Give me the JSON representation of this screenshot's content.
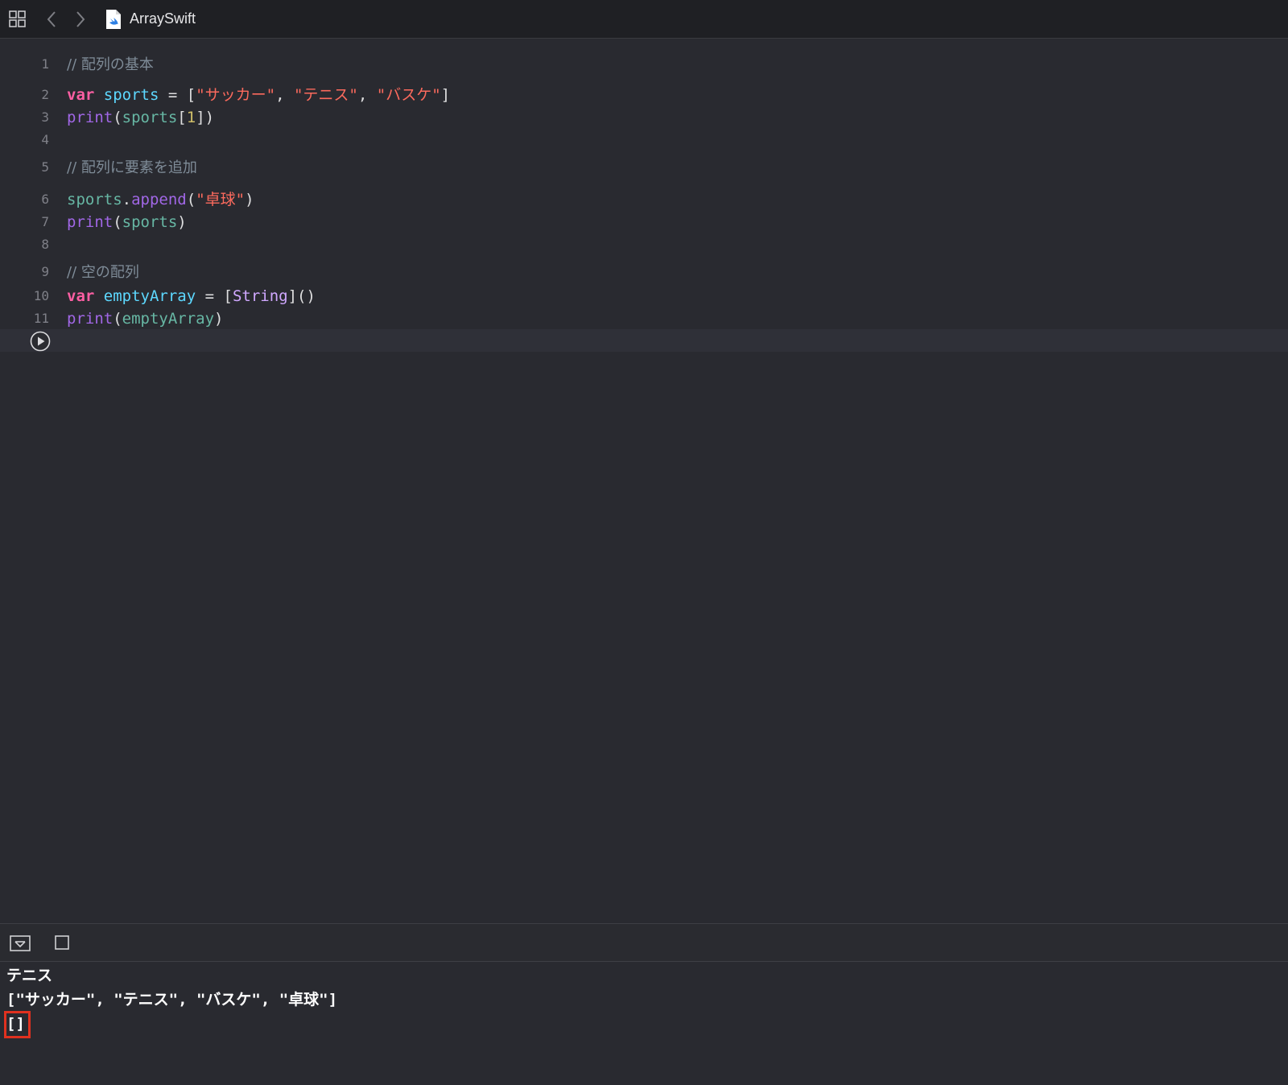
{
  "toolbar": {
    "file_title": "ArraySwift",
    "icons": [
      "grid-icon",
      "chevron-left-icon",
      "chevron-right-icon",
      "swift-file-icon"
    ]
  },
  "editor": {
    "lines": [
      {
        "num": "1",
        "tokens": [
          {
            "t": "cmt",
            "v": "// 配列の基本"
          }
        ]
      },
      {
        "num": "2",
        "tokens": [
          {
            "t": "kw",
            "v": "var"
          },
          {
            "t": "plain",
            "v": " "
          },
          {
            "t": "var",
            "v": "sports"
          },
          {
            "t": "plain",
            "v": " = ["
          },
          {
            "t": "str",
            "v": "\"サッカー\""
          },
          {
            "t": "plain",
            "v": ", "
          },
          {
            "t": "str",
            "v": "\"テニス\""
          },
          {
            "t": "plain",
            "v": ", "
          },
          {
            "t": "str",
            "v": "\"バスケ\""
          },
          {
            "t": "plain",
            "v": "]"
          }
        ]
      },
      {
        "num": "3",
        "tokens": [
          {
            "t": "fn",
            "v": "print"
          },
          {
            "t": "plain",
            "v": "("
          },
          {
            "t": "ref",
            "v": "sports"
          },
          {
            "t": "plain",
            "v": "["
          },
          {
            "t": "num",
            "v": "1"
          },
          {
            "t": "plain",
            "v": "])"
          }
        ]
      },
      {
        "num": "4",
        "tokens": []
      },
      {
        "num": "5",
        "tokens": [
          {
            "t": "cmt",
            "v": "// 配列に要素を追加"
          }
        ]
      },
      {
        "num": "6",
        "tokens": [
          {
            "t": "ref",
            "v": "sports"
          },
          {
            "t": "plain",
            "v": "."
          },
          {
            "t": "fn",
            "v": "append"
          },
          {
            "t": "plain",
            "v": "("
          },
          {
            "t": "str",
            "v": "\"卓球\""
          },
          {
            "t": "plain",
            "v": ")"
          }
        ]
      },
      {
        "num": "7",
        "tokens": [
          {
            "t": "fn",
            "v": "print"
          },
          {
            "t": "plain",
            "v": "("
          },
          {
            "t": "ref",
            "v": "sports"
          },
          {
            "t": "plain",
            "v": ")"
          }
        ]
      },
      {
        "num": "8",
        "tokens": []
      },
      {
        "num": "9",
        "tokens": [
          {
            "t": "cmt",
            "v": "// 空の配列"
          }
        ]
      },
      {
        "num": "10",
        "tokens": [
          {
            "t": "kw",
            "v": "var"
          },
          {
            "t": "plain",
            "v": " "
          },
          {
            "t": "var",
            "v": "emptyArray"
          },
          {
            "t": "plain",
            "v": " = ["
          },
          {
            "t": "type",
            "v": "String"
          },
          {
            "t": "plain",
            "v": "]()"
          }
        ]
      },
      {
        "num": "11",
        "tokens": [
          {
            "t": "fn",
            "v": "print"
          },
          {
            "t": "plain",
            "v": "("
          },
          {
            "t": "ref",
            "v": "emptyArray"
          },
          {
            "t": "plain",
            "v": ")"
          }
        ]
      }
    ]
  },
  "console": {
    "output": [
      "テニス",
      "[\"サッカー\", \"テニス\", \"バスケ\", \"卓球\"]",
      "[]"
    ]
  },
  "colors": {
    "keyword": "#fc5fa3",
    "string": "#fc6a5d",
    "function": "#a167e6",
    "highlight_box": "#e0311f"
  }
}
